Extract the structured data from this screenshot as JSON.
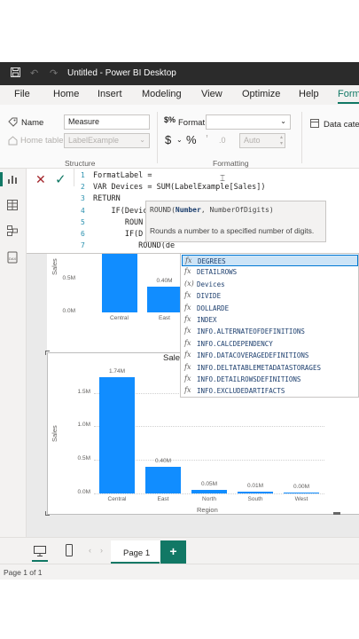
{
  "window": {
    "title": "Untitled - Power BI Desktop"
  },
  "menu": [
    "File",
    "Home",
    "Insert",
    "Modeling",
    "View",
    "Optimize",
    "Help",
    "Form"
  ],
  "ribbon": {
    "name_label": "Name",
    "name_value": "Measure",
    "home_table_label": "Home table",
    "home_table_value": "LabelExample",
    "structure_label": "Structure",
    "format_label": "Format",
    "currency_symbol": "$",
    "percent_symbol": "%",
    "comma_symbol": "’",
    "decimals_value": "Auto",
    "formatting_label": "Formatting",
    "data_category_label": "Data categ"
  },
  "formula": {
    "lines": [
      {
        "n": "1",
        "text": "FormatLabel ="
      },
      {
        "n": "2",
        "text": "VAR Devices = SUM(LabelExample[Sales])"
      },
      {
        "n": "3",
        "text": "RETURN"
      },
      {
        "n": "4",
        "text": "    IF(Devic"
      },
      {
        "n": "5",
        "text": "       ROUN"
      },
      {
        "n": "6",
        "text": "       IF(D"
      },
      {
        "n": "7",
        "text": "          ROUND(de"
      }
    ]
  },
  "tooltip": {
    "signature_fn": "ROUND(",
    "signature_arg1": "Number",
    "signature_rest": ", NumberOfDigits)",
    "description": "Rounds a number to a specified number of digits."
  },
  "autocomplete": [
    {
      "icon": "fx",
      "name": "DEGREES"
    },
    {
      "icon": "fx",
      "name": "DETAILROWS"
    },
    {
      "icon": "(x)",
      "name": "Devices"
    },
    {
      "icon": "fx",
      "name": "DIVIDE"
    },
    {
      "icon": "fx",
      "name": "DOLLARDE"
    },
    {
      "icon": "fx",
      "name": "INDEX"
    },
    {
      "icon": "fx",
      "name": "INFO.ALTERNATEOFDEFINITIONS"
    },
    {
      "icon": "fx",
      "name": "INFO.CALCDEPENDENCY"
    },
    {
      "icon": "fx",
      "name": "INFO.DATACOVERAGEDEFINITIONS"
    },
    {
      "icon": "fx",
      "name": "INFO.DELTATABLEMETADATASTORAGES"
    },
    {
      "icon": "fx",
      "name": "INFO.DETAILROWSDEFINITIONS"
    },
    {
      "icon": "fx",
      "name": "INFO.EXCLUDEDARTIFACTS"
    }
  ],
  "chart_data": [
    {
      "type": "bar",
      "title": "",
      "ylabel": "Sales",
      "xlabel": "",
      "yticks": [
        "1.5M",
        "1.0M",
        "0.5M",
        "0.0M"
      ],
      "categories": [
        "Central",
        "East"
      ],
      "values": [
        1.74,
        0.4
      ],
      "data_labels": [
        "",
        "0.40M"
      ],
      "ylim": [
        0,
        1.8
      ]
    },
    {
      "type": "bar",
      "title": "Sale",
      "ylabel": "Sales",
      "xlabel": "Region",
      "yticks": [
        "1.5M",
        "1.0M",
        "0.5M",
        "0.0M"
      ],
      "categories": [
        "Central",
        "East",
        "North",
        "South",
        "West"
      ],
      "values": [
        1.74,
        0.4,
        0.05,
        0.01,
        0.0
      ],
      "data_labels": [
        "1.74M",
        "0.40M",
        "0.05M",
        "0.01M",
        "0.00M"
      ],
      "ylim": [
        0,
        1.8
      ]
    }
  ],
  "pages": {
    "tab_label": "Page 1",
    "add_label": "+",
    "status": "Page 1 of 1"
  },
  "colors": {
    "bar": "#118dff",
    "accent": "#117865",
    "add_tab": "#117865"
  }
}
